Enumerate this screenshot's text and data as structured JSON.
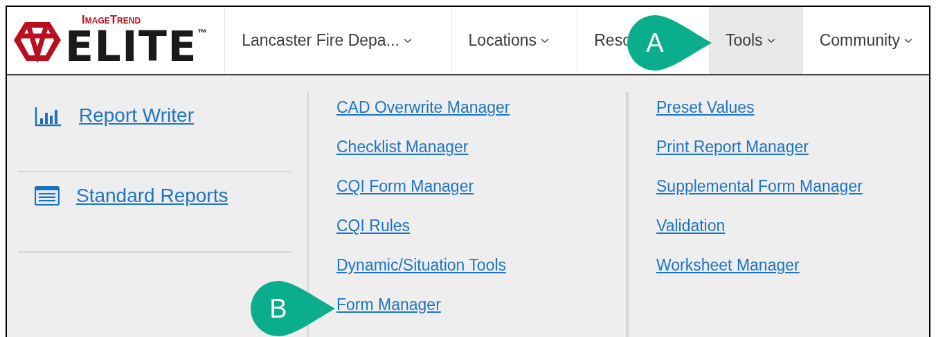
{
  "logo": {
    "brand": "ImageTrend",
    "product": "ELITE",
    "trademark": "™"
  },
  "nav": [
    {
      "label": "Lancaster Fire Depa...",
      "selected": false,
      "caret": true
    },
    {
      "label": "Locations",
      "selected": false,
      "caret": true
    },
    {
      "label": "Reso",
      "selected": false,
      "caret": false
    },
    {
      "label": "Tools",
      "selected": true,
      "caret": true
    },
    {
      "label": "Community",
      "selected": false,
      "caret": true
    }
  ],
  "menu": {
    "featured": [
      {
        "label": "Report Writer",
        "kind": "chart"
      },
      {
        "label": "Standard Reports",
        "kind": "list"
      }
    ],
    "columns": [
      [
        "CAD Overwrite Manager",
        "Checklist Manager",
        "CQI Form Manager",
        "CQI Rules",
        "Dynamic/Situation Tools",
        "Form Manager"
      ],
      [
        "Preset Values",
        "Print Report Manager",
        "Supplemental Form Manager",
        "Validation",
        "Worksheet Manager"
      ]
    ]
  },
  "callouts": [
    {
      "letter": "A"
    },
    {
      "letter": "B"
    }
  ]
}
